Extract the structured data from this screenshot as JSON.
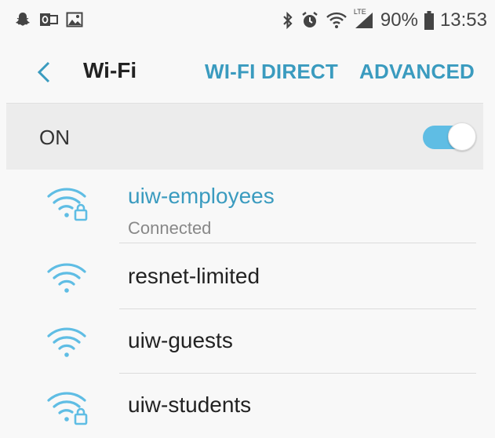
{
  "status_bar": {
    "battery": "90%",
    "time": "13:53",
    "network_type": "LTE",
    "left_icons": [
      "snapchat-icon",
      "outlook-icon",
      "gallery-icon"
    ],
    "right_icons": [
      "bluetooth-icon",
      "alarm-icon",
      "wifi-icon",
      "signal-icon",
      "battery-icon"
    ]
  },
  "toolbar": {
    "title": "Wi-Fi",
    "wifi_direct": "WI-FI DIRECT",
    "advanced": "ADVANCED"
  },
  "master_switch": {
    "label": "ON",
    "state": "on"
  },
  "networks": [
    {
      "name": "uiw-employees",
      "status": "Connected",
      "secured": true,
      "connected": true
    },
    {
      "name": "resnet-limited",
      "status": "",
      "secured": false,
      "connected": false
    },
    {
      "name": "uiw-guests",
      "status": "",
      "secured": false,
      "connected": false
    },
    {
      "name": "uiw-students",
      "status": "",
      "secured": true,
      "connected": false
    }
  ],
  "colors": {
    "accent": "#3a9bbf",
    "toggle_on": "#5fbde4",
    "wifi_icon": "#5fbde4",
    "background": "#f8f8f8"
  }
}
